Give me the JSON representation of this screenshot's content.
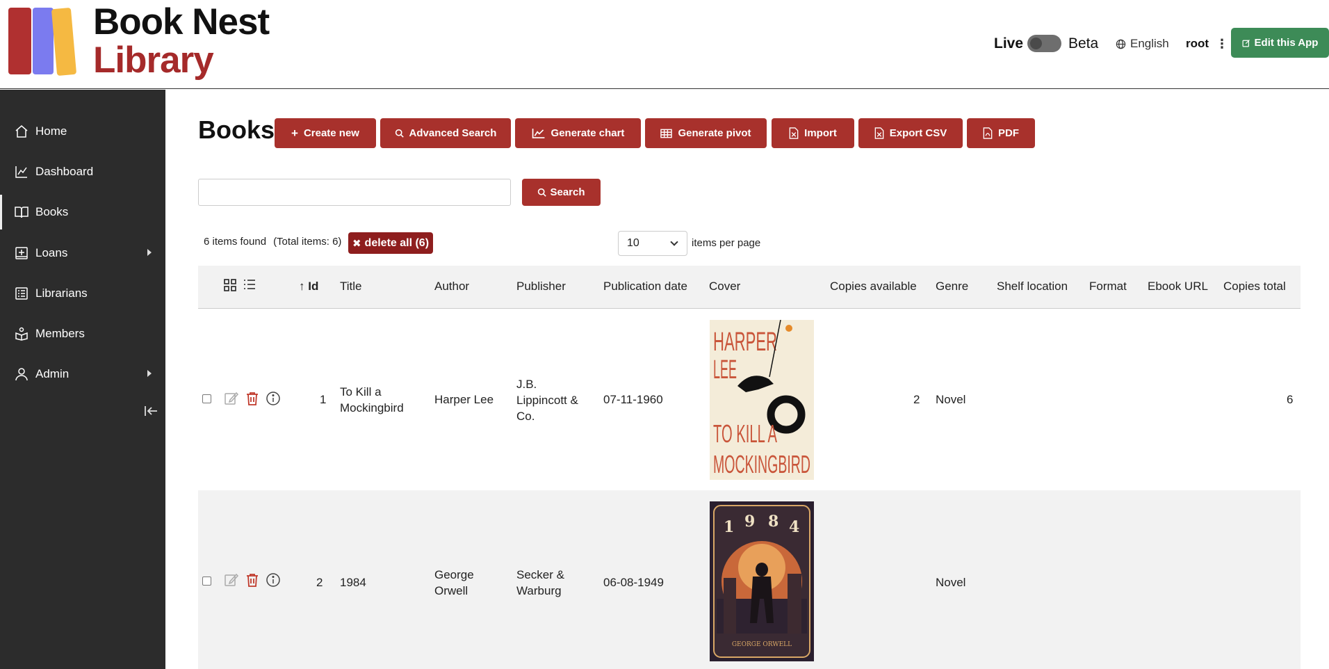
{
  "app": {
    "brand_line1": "Book Nest",
    "brand_line2": "Library",
    "mode_live": "Live",
    "mode_beta": "Beta",
    "language": "English",
    "user": "root",
    "edit_app_label": "Edit this App",
    "colors": {
      "brand_red": "#a52a2a",
      "button_red": "#a8312c",
      "edit_green": "#3d8b57",
      "sidebar_bg": "#2c2c2c"
    }
  },
  "sidebar": {
    "items": [
      {
        "label": "Home",
        "icon": "home-icon"
      },
      {
        "label": "Dashboard",
        "icon": "chart-line-icon"
      },
      {
        "label": "Books",
        "icon": "book-open-icon",
        "active": true
      },
      {
        "label": "Loans",
        "icon": "plus-square-icon",
        "submenu": true
      },
      {
        "label": "Librarians",
        "icon": "list-icon"
      },
      {
        "label": "Members",
        "icon": "reader-icon"
      },
      {
        "label": "Admin",
        "icon": "user-icon",
        "submenu": true
      }
    ],
    "collapse_icon": "collapse-left-icon"
  },
  "main": {
    "title": "Books",
    "toolbar": {
      "create_new": "Create new",
      "advanced_search": "Advanced Search",
      "generate_chart": "Generate chart",
      "generate_pivot": "Generate pivot",
      "import": "Import",
      "export_csv": "Export CSV",
      "pdf": "PDF"
    },
    "search": {
      "value": "",
      "placeholder": "",
      "button": "Search"
    },
    "results": {
      "found": "6 items found",
      "total": "(Total items: 6)",
      "delete_all": "delete all (6)",
      "per_page_value": "10",
      "per_page_label": "items per page"
    },
    "table": {
      "columns": [
        "Id",
        "Title",
        "Author",
        "Publisher",
        "Publication date",
        "Cover",
        "Copies available",
        "Genre",
        "Shelf location",
        "Format",
        "Ebook URL",
        "Copies total"
      ],
      "sort_indicator": "↑",
      "rows": [
        {
          "id": "1",
          "title": "To Kill a Mockingbird",
          "author": "Harper Lee",
          "publisher": "J.B. Lippincott & Co.",
          "publication_date": "07-11-1960",
          "cover_text": [
            "HARPER",
            "LEE",
            "TO KILL A",
            "MOCKINGBIRD"
          ],
          "copies_available": "2",
          "genre": "Novel",
          "shelf_location": "",
          "format": "",
          "ebook_url": "",
          "copies_total": "6"
        },
        {
          "id": "2",
          "title": "1984",
          "author": "George Orwell",
          "publisher": "Secker & Warburg",
          "publication_date": "06-08-1949",
          "cover_text": [
            "1",
            "9",
            "8",
            "4",
            "GEORGE ORWELL"
          ],
          "copies_available": "",
          "genre": "Novel",
          "shelf_location": "",
          "format": "",
          "ebook_url": "",
          "copies_total": ""
        }
      ]
    }
  }
}
